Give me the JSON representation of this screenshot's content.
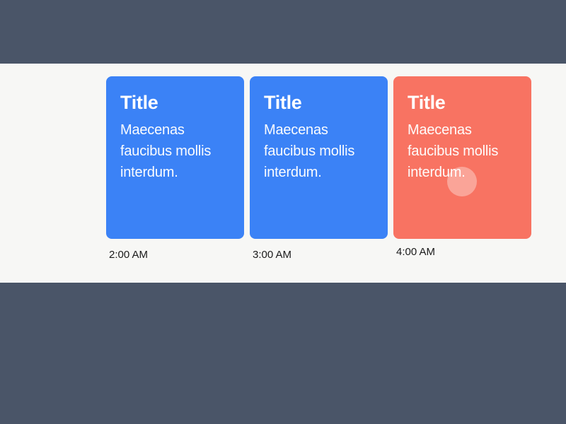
{
  "timeline": {
    "items": [
      {
        "title": "Title",
        "body": "Maecenas faucibus mollis interdum.",
        "time": "2:00 AM",
        "variant": "blue"
      },
      {
        "title": "Title",
        "body": "Maecenas faucibus mollis interdum.",
        "time": "3:00 AM",
        "variant": "blue"
      },
      {
        "title": "Title",
        "body": "Maecenas faucibus mollis interdum.",
        "time": "4:00 AM",
        "variant": "orange"
      }
    ]
  }
}
